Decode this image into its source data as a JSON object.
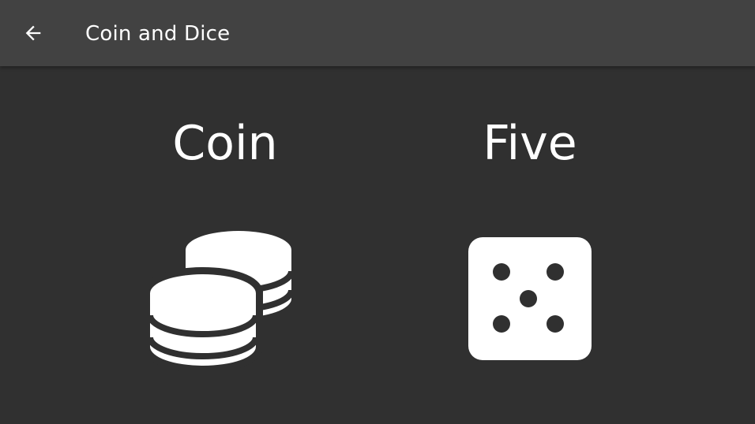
{
  "app_bar": {
    "title": "Coin and Dice",
    "back_icon": "arrow-left-icon"
  },
  "coin": {
    "label": "Coin",
    "icon": "coins-icon"
  },
  "dice": {
    "label": "Five",
    "icon": "dice-five-icon",
    "value": 5
  },
  "colors": {
    "background": "#303030",
    "app_bar": "#424242",
    "foreground": "#ffffff"
  }
}
